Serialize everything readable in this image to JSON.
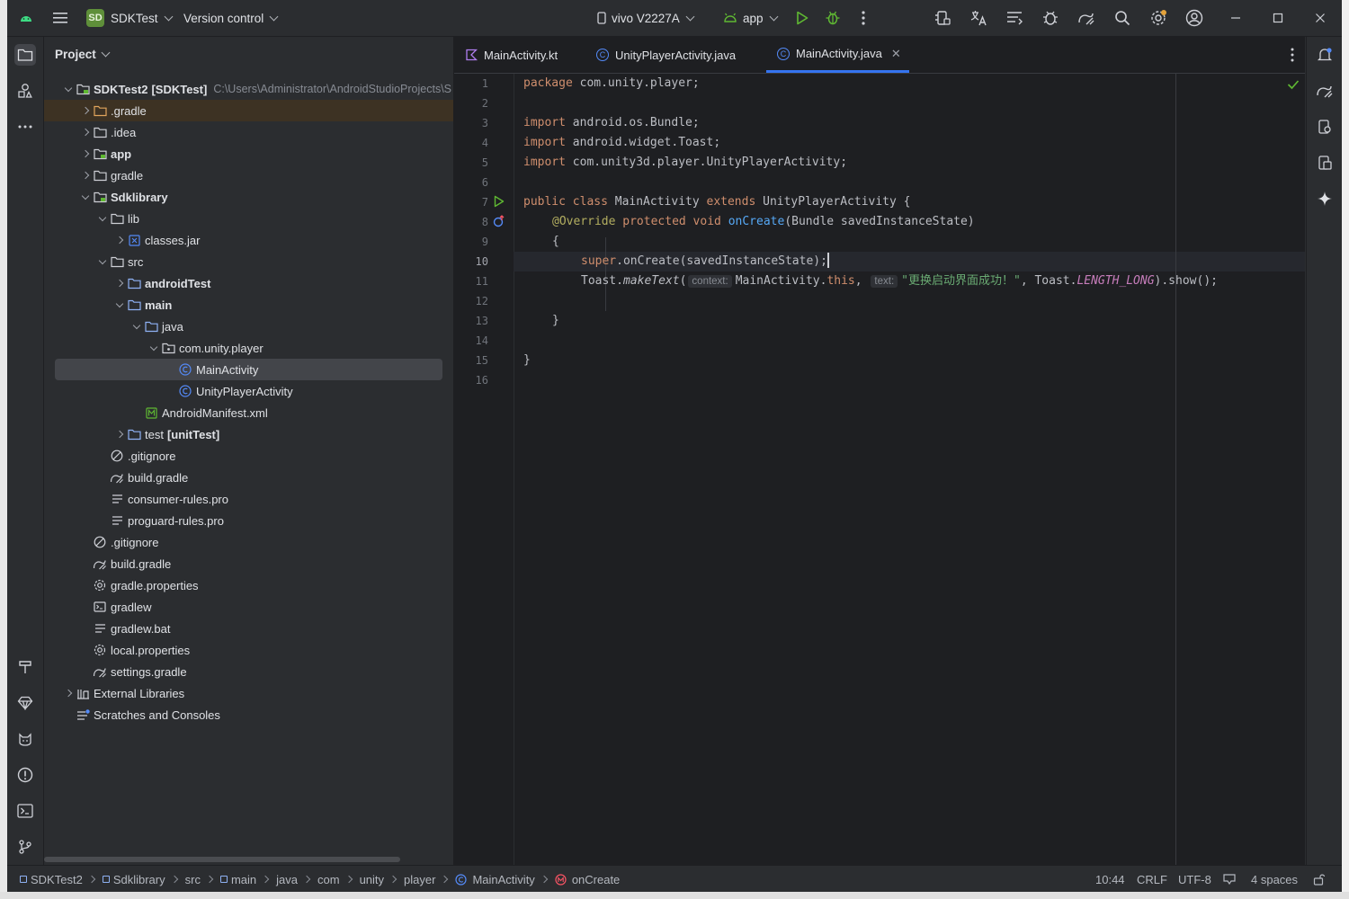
{
  "titlebar": {
    "project_badge": "SD",
    "project_name": "SDKTest",
    "version_control": "Version control",
    "device": "vivo V2227A",
    "run_config": "app"
  },
  "project_panel": {
    "title": "Project",
    "root_path": "C:\\Users\\Administrator\\AndroidStudioProjects\\S",
    "rows": [
      {
        "label": "SDKTest2",
        "extra": "[SDKTest]"
      },
      {
        "label": ".gradle"
      },
      {
        "label": ".idea"
      },
      {
        "label": "app"
      },
      {
        "label": "gradle"
      },
      {
        "label": "Sdklibrary"
      },
      {
        "label": "lib"
      },
      {
        "label": "classes.jar"
      },
      {
        "label": "src"
      },
      {
        "label": "androidTest"
      },
      {
        "label": "main"
      },
      {
        "label": "java"
      },
      {
        "label": "com.unity.player"
      },
      {
        "label": "MainActivity"
      },
      {
        "label": "UnityPlayerActivity"
      },
      {
        "label": "AndroidManifest.xml"
      },
      {
        "label": "test",
        "extra": "[unitTest]"
      },
      {
        "label": ".gitignore"
      },
      {
        "label": "build.gradle"
      },
      {
        "label": "consumer-rules.pro"
      },
      {
        "label": "proguard-rules.pro"
      },
      {
        "label": ".gitignore"
      },
      {
        "label": "build.gradle"
      },
      {
        "label": "gradle.properties"
      },
      {
        "label": "gradlew"
      },
      {
        "label": "gradlew.bat"
      },
      {
        "label": "local.properties"
      },
      {
        "label": "settings.gradle"
      },
      {
        "label": "External Libraries"
      },
      {
        "label": "Scratches and Consoles"
      }
    ]
  },
  "editor": {
    "tabs": [
      {
        "label": "MainActivity.kt"
      },
      {
        "label": "UnityPlayerActivity.java"
      },
      {
        "label": "MainActivity.java"
      }
    ],
    "line_numbers": [
      "1",
      "2",
      "3",
      "4",
      "5",
      "6",
      "7",
      "8",
      "9",
      "10",
      "11",
      "12",
      "13",
      "14",
      "15",
      "16"
    ],
    "code": {
      "l1": {
        "kw": "package",
        "rest": " com.unity.player;"
      },
      "l3": {
        "kw": "import",
        "rest": " android.os.Bundle;"
      },
      "l4": {
        "kw": "import",
        "rest": " android.widget.Toast;"
      },
      "l5": {
        "kw": "import",
        "rest": " com.unity3d.player.UnityPlayerActivity;"
      },
      "l7": {
        "kw1": "public class",
        "name": " MainActivity ",
        "kw2": "extends",
        "rest": " UnityPlayerActivity {"
      },
      "l8": {
        "ann": "@Override",
        "kw": " protected void ",
        "fn": "onCreate",
        "rest": "(Bundle savedInstanceState)"
      },
      "l9": "{",
      "l10": {
        "kw": "super",
        "rest": ".onCreate(savedInstanceState);"
      },
      "l11": {
        "obj": "Toast.",
        "method": "makeText",
        "open": "(",
        "hint1": "context:",
        "arg1": "MainActivity.",
        "this": "this",
        "comma": ", ",
        "hint2": "text:",
        "str": "\"更换启动界面成功！\"",
        "comma2": ", Toast.",
        "const": "LENGTH_LONG",
        "close": ").show();"
      },
      "l13": "}",
      "l15": "}"
    }
  },
  "statusbar": {
    "breadcrumbs": [
      "SDKTest2",
      "Sdklibrary",
      "src",
      "main",
      "java",
      "com",
      "unity",
      "player",
      "MainActivity",
      "onCreate"
    ],
    "position": "10:44",
    "line_sep": "CRLF",
    "encoding": "UTF-8",
    "indent": "4 spaces"
  },
  "colors": {
    "accent": "#3574f0",
    "keyword": "#cf8e6d",
    "string": "#6aab73",
    "function": "#56a8f5",
    "annotation": "#b3ae60"
  }
}
